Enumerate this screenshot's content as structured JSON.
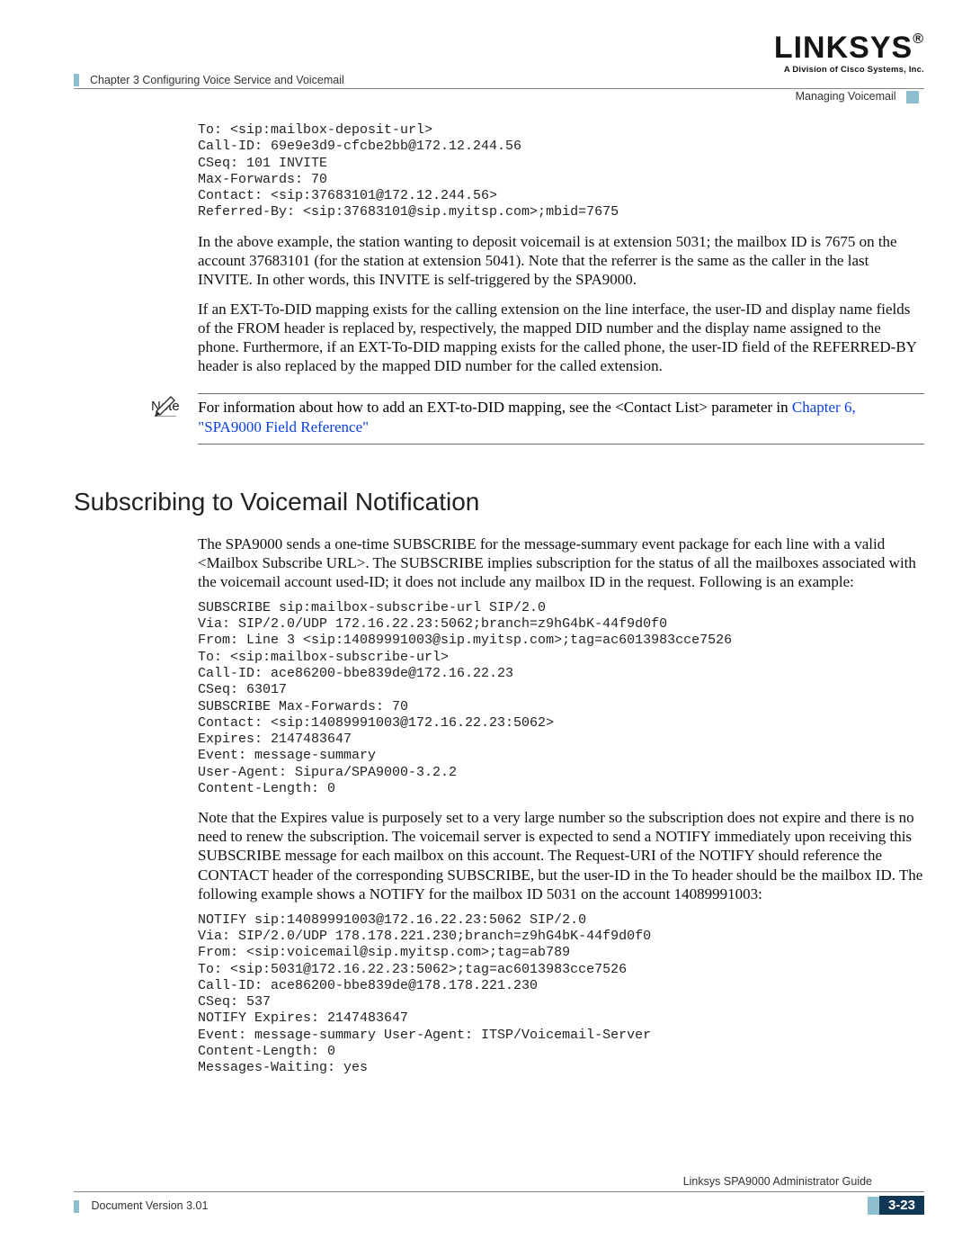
{
  "logo": {
    "brand": "LINKSYS",
    "tag": "A Division of Cisco Systems, Inc."
  },
  "header": {
    "chapter": "Chapter 3      Configuring Voice Service and Voicemail",
    "section": "Managing Voicemail"
  },
  "code1": "To: <sip:mailbox-deposit-url>\nCall-ID: 69e9e3d9-cfcbe2bb@172.12.244.56\nCSeq: 101 INVITE\nMax-Forwards: 70\nContact: <sip:37683101@172.12.244.56>\nReferred-By: <sip:37683101@sip.myitsp.com>;mbid=7675",
  "para1": "In the above example, the station wanting to deposit voicemail is at extension 5031; the mailbox ID is 7675 on the account 37683101 (for the station at extension 5041). Note that the referrer is the same as the caller in the last INVITE. In other words, this INVITE is self-triggered by the SPA9000.",
  "para2": "If an EXT-To-DID mapping exists for the calling extension on the line interface, the user-ID and display name fields of the FROM header is replaced by, respectively, the mapped DID number and the display name assigned to the phone. Furthermore, if an EXT-To-DID mapping exists for the called phone, the user-ID field of the REFERRED-BY header is also replaced by the mapped DID number for the called extension.",
  "note": {
    "label": "Note",
    "body_pre": "For information about how to add an EXT-to-DID mapping, see the <Contact List> parameter in ",
    "link": "Chapter 6, \"SPA9000 Field Reference\""
  },
  "h2": "Subscribing to Voicemail Notification",
  "para3": "The SPA9000 sends a one-time SUBSCRIBE for the message-summary event package for each line with a valid <Mailbox Subscribe URL>. The SUBSCRIBE implies subscription for the status of all the mailboxes associated with the voicemail account used-ID; it does not include any mailbox ID in the request. Following is an example:",
  "code2": "SUBSCRIBE sip:mailbox-subscribe-url SIP/2.0\nVia: SIP/2.0/UDP 172.16.22.23:5062;branch=z9hG4bK-44f9d0f0\nFrom: Line 3 <sip:14089991003@sip.myitsp.com>;tag=ac6013983cce7526\nTo: <sip:mailbox-subscribe-url>\nCall-ID: ace86200-bbe839de@172.16.22.23\nCSeq: 63017\nSUBSCRIBE Max-Forwards: 70\nContact: <sip:14089991003@172.16.22.23:5062>\nExpires: 2147483647\nEvent: message-summary\nUser-Agent: Sipura/SPA9000-3.2.2\nContent-Length: 0",
  "para4": "Note that the Expires value is purposely set to a very large number so the subscription does not expire and there is no need to renew the subscription. The voicemail server is expected to send a NOTIFY immediately upon receiving this SUBSCRIBE message for each mailbox on this account. The Request-URI of the NOTIFY should reference the CONTACT header of the corresponding SUBSCRIBE, but the user-ID in the To header should be the mailbox ID. The following example shows a NOTIFY for the mailbox ID 5031 on the account 14089991003:",
  "code3": "NOTIFY sip:14089991003@172.16.22.23:5062 SIP/2.0\nVia: SIP/2.0/UDP 178.178.221.230;branch=z9hG4bK-44f9d0f0\nFrom: <sip:voicemail@sip.myitsp.com>;tag=ab789\nTo: <sip:5031@172.16.22.23:5062>;tag=ac6013983cce7526\nCall-ID: ace86200-bbe839de@178.178.221.230\nCSeq: 537\nNOTIFY Expires: 2147483647\nEvent: message-summary User-Agent: ITSP/Voicemail-Server\nContent-Length: 0\nMessages-Waiting: yes",
  "footer": {
    "guide": "Linksys SPA9000 Administrator Guide",
    "version": "Document Version 3.01",
    "pagenum": "3-23"
  }
}
